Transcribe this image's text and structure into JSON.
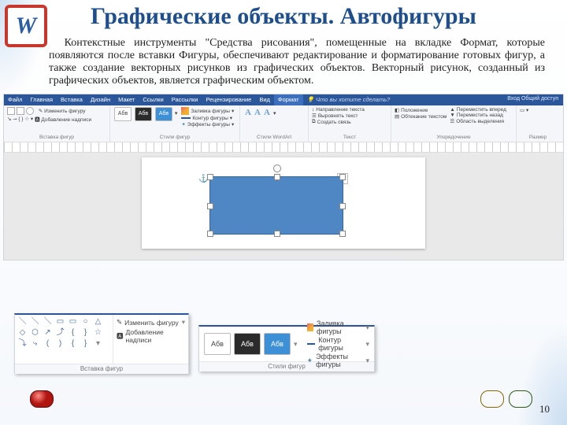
{
  "title": "Графические объекты. Автофигуры",
  "body": "Контекстные инструменты \"Средства рисования\", помещенные на вкладке Формат, которые появляются после вставки Фигуры, обеспечивают редактирование и форматирование готовых фигур, а также создание векторных рисунков из графических объектов. Векторный рисунок, созданный из графических объектов, является графическим объектом.",
  "ribbon": {
    "tabs": [
      "Файл",
      "Главная",
      "Вставка",
      "Дизайн",
      "Макет",
      "Ссылки",
      "Рассылки",
      "Рецензирование",
      "Вид"
    ],
    "active_tab": "Формат",
    "search": "Что вы хотите сделать?",
    "user": "Вход  Общий доступ",
    "groups": {
      "insert": {
        "edit_shape": "Изменить фигуру",
        "add_text": "Добавление надписи",
        "label": "Вставка фигур"
      },
      "styles": {
        "sample": "Абв",
        "fill": "Заливка фигуры",
        "outline": "Контур фигуры",
        "effects": "Эффекты фигуры",
        "label": "Стили фигур"
      },
      "wordart": {
        "label": "Стили WordArt"
      },
      "text": {
        "direction": "Направление текста",
        "align": "Выровнять текст",
        "link": "Создать связь",
        "label": "Текст"
      },
      "arrange": {
        "position": "Положение",
        "wrap": "Обтекание текстом",
        "forward": "Переместить вперед",
        "backward": "Переместить назад",
        "selection": "Область выделения",
        "label": "Упорядочение"
      },
      "size": {
        "label": "Размер"
      }
    }
  },
  "callout1": {
    "edit_shape": "Изменить фигуру",
    "add_caption": "Добавление надписи",
    "label": "Вставка фигур"
  },
  "callout2": {
    "sample": "Абв",
    "fill": "Заливка фигуры",
    "outline": "Контур фигуры",
    "effects": "Эффекты фигуры",
    "label": "Стили фигур"
  },
  "page_number": "10"
}
